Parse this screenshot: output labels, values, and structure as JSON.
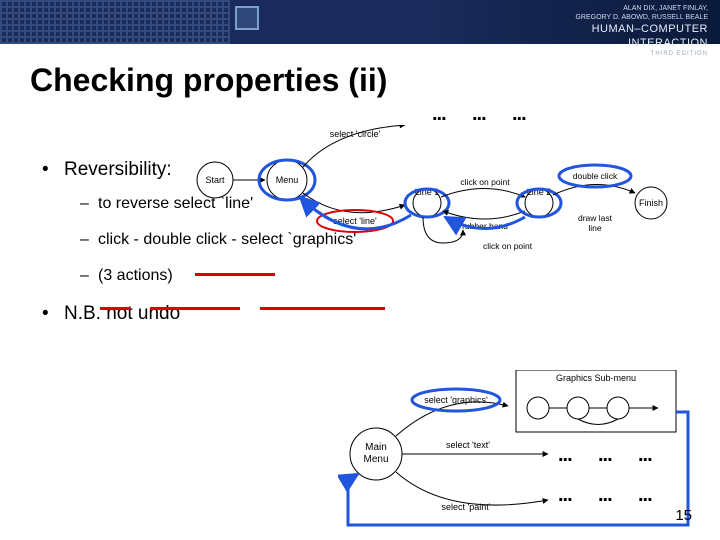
{
  "header": {
    "authors": "ALAN DIX, JANET FINLAY,",
    "authors2": "GREGORY D. ABOWD, RUSSELL BEALE",
    "book_title_1": "HUMAN–COMPUTER",
    "book_title_2": "INTERACTION",
    "edition": "THIRD EDITION"
  },
  "title": "Checking properties (ii)",
  "bullets": {
    "b1": "Reversibility:",
    "s1": "to reverse select `line'",
    "s2": "click - double click - select `graphics'",
    "s3": "(3 actions)",
    "b2": "N.B. not undo"
  },
  "diagram1": {
    "start": "Start",
    "menu": "Menu",
    "sel_circle": "select 'circle'",
    "sel_line": "select 'line'",
    "line1": "Line 1",
    "line2": "Line 2",
    "finish": "Finish",
    "click_on_point": "click on point",
    "rubber_band": "rubber band",
    "double_click": "double click",
    "draw_last": "draw last",
    "draw_line": "line"
  },
  "diagram2": {
    "main_menu": "Main",
    "main_menu2": "Menu",
    "submenu_title": "Graphics Sub-menu",
    "sel_graphics": "select 'graphics'",
    "sel_text": "select 'text'",
    "sel_paint": "select 'paint'"
  },
  "page_number": "15"
}
